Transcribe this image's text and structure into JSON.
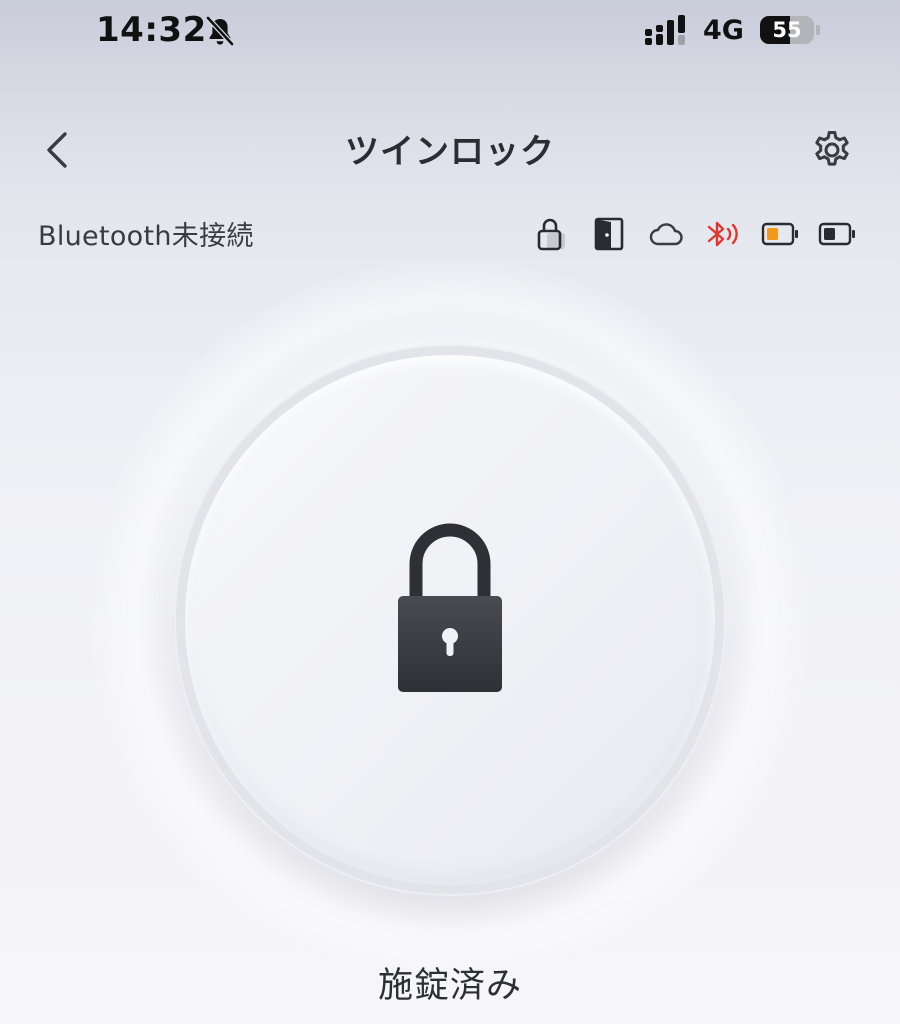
{
  "status_bar": {
    "time": "14:32",
    "network": "4G",
    "battery_level": "55",
    "battery_fraction": 0.55,
    "icons": [
      "bell-muted-icon",
      "signal-icon",
      "battery-icon"
    ]
  },
  "nav": {
    "title": "ツインロック",
    "icons": [
      "chevron-left-icon",
      "gear-icon"
    ]
  },
  "connection": {
    "label": "Bluetooth未接続",
    "status_icons": [
      "lock-status-icon",
      "door-status-icon",
      "cloud-icon",
      "bluetooth-signal-icon",
      "battery-low-icon",
      "battery-icon"
    ]
  },
  "lock": {
    "state_label": "施錠済み",
    "icon": "padlock-icon"
  },
  "colors": {
    "text_primary": "#2c2d33",
    "bluetooth_alert": "#e2372f",
    "battery_warning": "#f39a1c",
    "lock_icon_dark": "#3a3b42"
  }
}
